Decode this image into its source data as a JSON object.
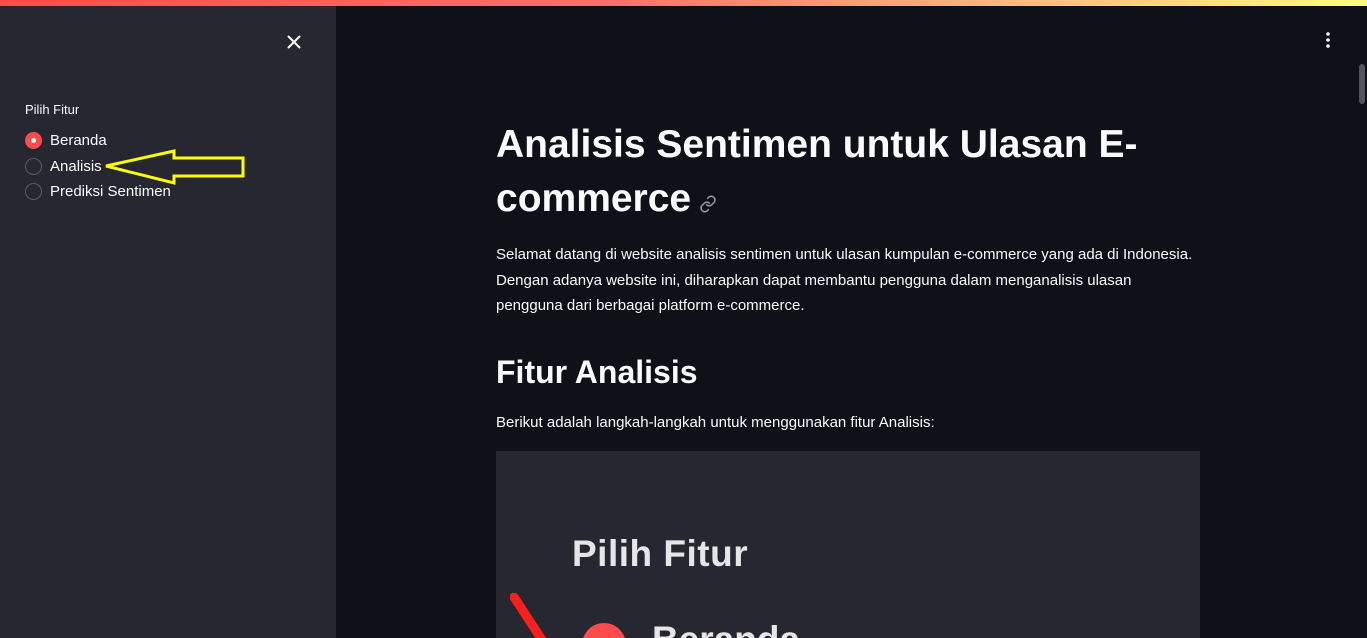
{
  "sidebar": {
    "heading": "Pilih Fitur",
    "options": [
      {
        "label": "Beranda",
        "selected": true
      },
      {
        "label": "Analisis",
        "selected": false
      },
      {
        "label": "Prediksi Sentimen",
        "selected": false
      }
    ],
    "annotation_color": "#ffff00"
  },
  "main": {
    "title": "Analisis Sentimen untuk Ulasan E-commerce",
    "intro": "Selamat datang di website analisis sentimen untuk ulasan kumpulan e-commerce yang ada di Indonesia. Dengan adanya website ini, diharapkan dapat membantu pengguna dalam menganalisis ulasan pengguna dari berbagai platform e-commerce.",
    "section_title": "Fitur Analisis",
    "steps_intro": "Berikut adalah langkah-langkah untuk menggunakan fitur Analisis:",
    "image": {
      "heading": "Pilih Fitur",
      "first_option_partial": "Beranda"
    }
  },
  "colors": {
    "accent": "#ff4b4b",
    "sidebar_bg": "#262730",
    "main_bg": "#0e1117"
  },
  "icons": {
    "close": "close-icon",
    "menu": "vertical-dots-icon",
    "anchor": "link-icon"
  }
}
